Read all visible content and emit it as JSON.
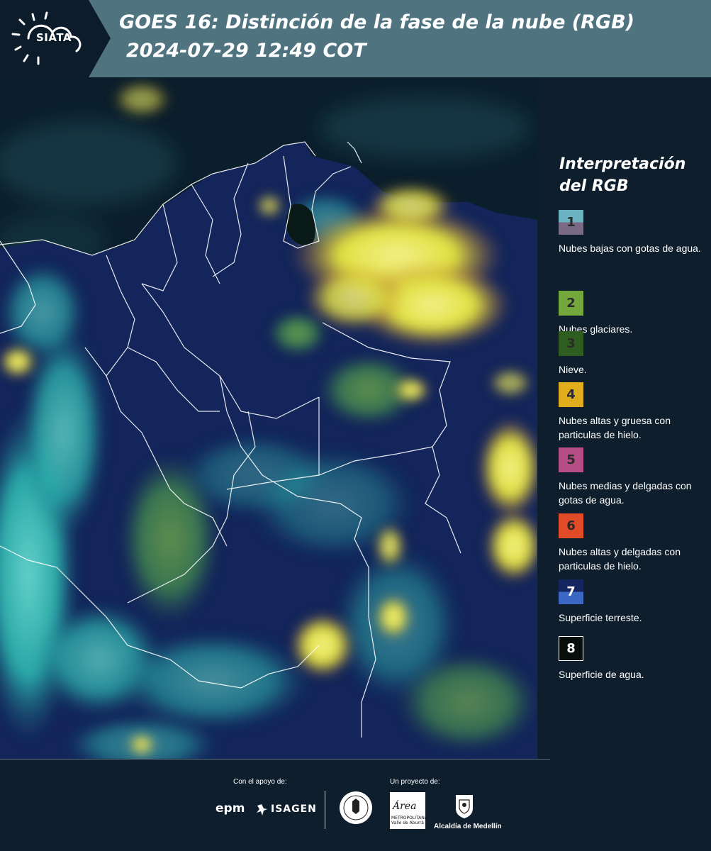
{
  "header": {
    "logo": "SIATA",
    "title_line1": "GOES 16: Distinción de la fase de la nube (RGB)",
    "title_line2": "2024-07-29 12:49 COT"
  },
  "legend": {
    "title": "Interpretación del RGB",
    "items": [
      {
        "num": "1",
        "label": "Nubes bajas con gotas de agua.",
        "colors": [
          "#6bb3c0",
          "#7a6a86"
        ]
      },
      {
        "num": "2",
        "label": "Nubes glaciares.",
        "colors": [
          "#75a83c"
        ]
      },
      {
        "num": "3",
        "label": "Nieve.",
        "colors": [
          "#2f5c1f"
        ]
      },
      {
        "num": "4",
        "label": "Nubes altas y gruesa con particulas de hielo.",
        "colors": [
          "#e2ad1d"
        ]
      },
      {
        "num": "5",
        "label": "Nubes medias y delgadas con gotas de agua.",
        "colors": [
          "#b44e85"
        ]
      },
      {
        "num": "6",
        "label": "Nubes altas y delgadas con particulas de hielo.",
        "colors": [
          "#e24b27"
        ]
      },
      {
        "num": "7",
        "label": "Superficie terreste.",
        "colors": [
          "#14245e",
          "#3c67c4"
        ]
      },
      {
        "num": "8",
        "label": "Superficie de agua.",
        "colors": [
          "#060f0b"
        ]
      }
    ]
  },
  "footer": {
    "support_label": "Con el apoyo de:",
    "project_label": "Un proyecto de:",
    "sponsor_1": "epm",
    "sponsor_2": "ISAGEN",
    "partner_1": "Área",
    "partner_1_sub": "METROPOLITANA Valle de Aburrá",
    "partner_2": "Alcaldía de Medellín"
  },
  "colors": {
    "header_bg": "#4f7480",
    "page_bg": "#0e1e2c",
    "land": "#14245e",
    "cloud_yellow": "#e6e04a",
    "cloud_cyan": "#38c9c0"
  }
}
